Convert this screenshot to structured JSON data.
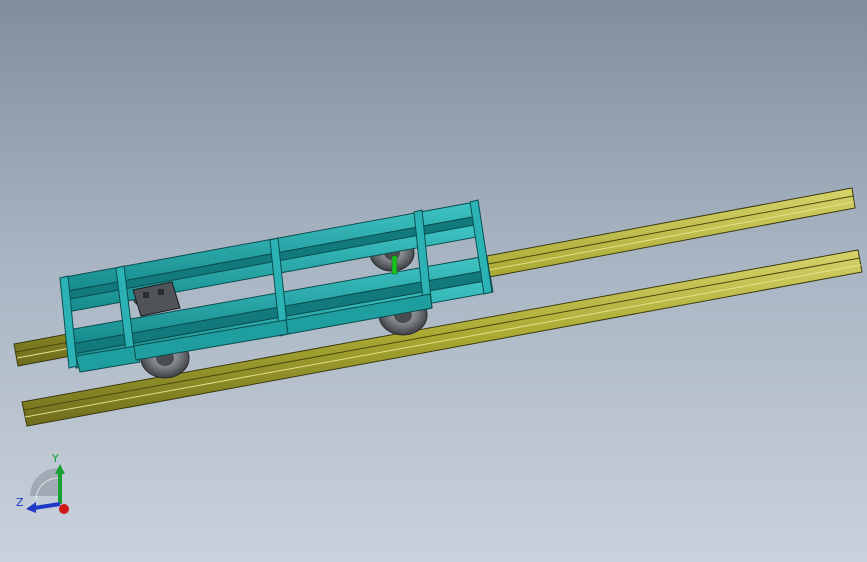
{
  "viewport": {
    "background_top": "#7f8d9e",
    "background_bottom": "#c9d2dc"
  },
  "model": {
    "frame_color": "#1f9ea0",
    "frame_dark": "#0f6e70",
    "rail_color": "#a8a832",
    "rail_dark": "#6e6c1c",
    "wheel_color": "#7a7d82",
    "wheel_dark": "#3c3e42"
  },
  "triad": {
    "y_label": "Y",
    "z_label": "Z",
    "x_color": "#d01818",
    "y_color": "#18a030",
    "z_color": "#2038c8"
  }
}
